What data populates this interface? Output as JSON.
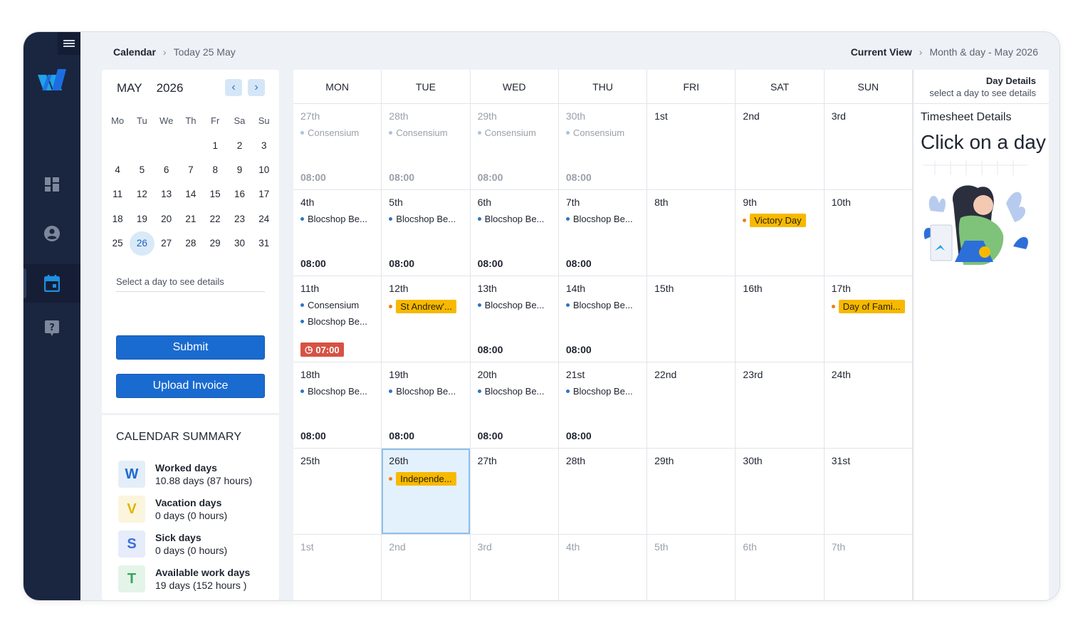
{
  "breadcrumb": {
    "root": "Calendar",
    "current": "Today 25 May"
  },
  "view": {
    "label": "Current View",
    "value": "Month & day - May 2026"
  },
  "mini_calendar": {
    "month": "MAY",
    "year": "2026",
    "weekdays": [
      "Mo",
      "Tu",
      "We",
      "Th",
      "Fr",
      "Sa",
      "Su"
    ],
    "weeks": [
      [
        "",
        "",
        "",
        "",
        "1",
        "2",
        "3"
      ],
      [
        "4",
        "5",
        "6",
        "7",
        "8",
        "9",
        "10"
      ],
      [
        "11",
        "12",
        "13",
        "14",
        "15",
        "16",
        "17"
      ],
      [
        "18",
        "19",
        "20",
        "21",
        "22",
        "23",
        "24"
      ],
      [
        "25",
        "26",
        "27",
        "28",
        "29",
        "30",
        "31"
      ]
    ],
    "selected": "26"
  },
  "left_panel": {
    "select_hint": "Select a day to see details",
    "submit_label": "Submit",
    "upload_label": "Upload Invoice"
  },
  "summary": {
    "title": "CALENDAR SUMMARY",
    "items": [
      {
        "letter": "W",
        "title": "Worked days",
        "detail": "10.88 days (87 hours)",
        "color": "#1a6bd0",
        "bg": "#e4eef8"
      },
      {
        "letter": "V",
        "title": "Vacation days",
        "detail": "0 days (0 hours)",
        "color": "#e2b400",
        "bg": "#fbf5de"
      },
      {
        "letter": "S",
        "title": "Sick days",
        "detail": "0 days (0 hours)",
        "color": "#3c6fd8",
        "bg": "#e6ecfa"
      },
      {
        "letter": "T",
        "title": "Available work days",
        "detail": "19 days (152 hours )",
        "color": "#37a35a",
        "bg": "#e4f4e9"
      }
    ]
  },
  "calendar": {
    "weekdays": [
      "MON",
      "TUE",
      "WED",
      "THU",
      "FRI",
      "SAT",
      "SUN"
    ],
    "cells": [
      [
        {
          "day": "27th",
          "muted": true,
          "events": [
            {
              "text": "Consensium",
              "muted": true
            }
          ],
          "time": "08:00"
        },
        {
          "day": "28th",
          "muted": true,
          "events": [
            {
              "text": "Consensium",
              "muted": true
            }
          ],
          "time": "08:00"
        },
        {
          "day": "29th",
          "muted": true,
          "events": [
            {
              "text": "Consensium",
              "muted": true
            }
          ],
          "time": "08:00"
        },
        {
          "day": "30th",
          "muted": true,
          "events": [
            {
              "text": "Consensium",
              "muted": true
            }
          ],
          "time": "08:00"
        },
        {
          "day": "1st",
          "events": []
        },
        {
          "day": "2nd",
          "events": []
        },
        {
          "day": "3rd",
          "events": []
        }
      ],
      [
        {
          "day": "4th",
          "events": [
            {
              "text": "Blocshop Be..."
            }
          ],
          "time": "08:00"
        },
        {
          "day": "5th",
          "events": [
            {
              "text": "Blocshop Be..."
            }
          ],
          "time": "08:00"
        },
        {
          "day": "6th",
          "events": [
            {
              "text": "Blocshop Be..."
            }
          ],
          "time": "08:00"
        },
        {
          "day": "7th",
          "events": [
            {
              "text": "Blocshop Be..."
            }
          ],
          "time": "08:00"
        },
        {
          "day": "8th",
          "events": []
        },
        {
          "day": "9th",
          "events": [
            {
              "text": "Victory Day",
              "holiday": true
            }
          ]
        },
        {
          "day": "10th",
          "events": []
        }
      ],
      [
        {
          "day": "11th",
          "events": [
            {
              "text": "Consensium"
            },
            {
              "text": "Blocshop Be..."
            }
          ],
          "alert": "07:00"
        },
        {
          "day": "12th",
          "events": [
            {
              "text": "St Andrew'...",
              "holiday": true
            }
          ]
        },
        {
          "day": "13th",
          "events": [
            {
              "text": "Blocshop Be..."
            }
          ],
          "time": "08:00"
        },
        {
          "day": "14th",
          "events": [
            {
              "text": "Blocshop Be..."
            }
          ],
          "time": "08:00"
        },
        {
          "day": "15th",
          "events": []
        },
        {
          "day": "16th",
          "events": []
        },
        {
          "day": "17th",
          "events": [
            {
              "text": "Day of Fami...",
              "holiday": true
            }
          ]
        }
      ],
      [
        {
          "day": "18th",
          "events": [
            {
              "text": "Blocshop Be..."
            }
          ],
          "time": "08:00"
        },
        {
          "day": "19th",
          "events": [
            {
              "text": "Blocshop Be..."
            }
          ],
          "time": "08:00"
        },
        {
          "day": "20th",
          "events": [
            {
              "text": "Blocshop Be..."
            }
          ],
          "time": "08:00"
        },
        {
          "day": "21st",
          "events": [
            {
              "text": "Blocshop Be..."
            }
          ],
          "time": "08:00"
        },
        {
          "day": "22nd",
          "events": []
        },
        {
          "day": "23rd",
          "events": []
        },
        {
          "day": "24th",
          "events": []
        }
      ],
      [
        {
          "day": "25th",
          "events": []
        },
        {
          "day": "26th",
          "today": true,
          "events": [
            {
              "text": "Independe...",
              "holiday": true
            }
          ]
        },
        {
          "day": "27th",
          "events": []
        },
        {
          "day": "28th",
          "events": []
        },
        {
          "day": "29th",
          "events": []
        },
        {
          "day": "30th",
          "events": []
        },
        {
          "day": "31st",
          "events": []
        }
      ],
      [
        {
          "day": "1st",
          "muted": true,
          "events": []
        },
        {
          "day": "2nd",
          "muted": true,
          "events": []
        },
        {
          "day": "3rd",
          "muted": true,
          "events": []
        },
        {
          "day": "4th",
          "muted": true,
          "events": []
        },
        {
          "day": "5th",
          "muted": true,
          "events": []
        },
        {
          "day": "6th",
          "muted": true,
          "events": []
        },
        {
          "day": "7th",
          "muted": true,
          "events": []
        }
      ]
    ]
  },
  "day_details": {
    "title": "Day Details",
    "hint": "select a day to see details",
    "timesheet_title": "Timesheet Details",
    "prompt": "Click on a day"
  },
  "nav": {
    "icons": [
      "dashboard-icon",
      "user-icon",
      "calendar-icon",
      "help-icon"
    ],
    "active": "calendar-icon"
  },
  "colors": {
    "sidebar": "#1a2540",
    "primary": "#1a6bd0",
    "holiday": "#f7b900",
    "alert": "#d65244"
  }
}
